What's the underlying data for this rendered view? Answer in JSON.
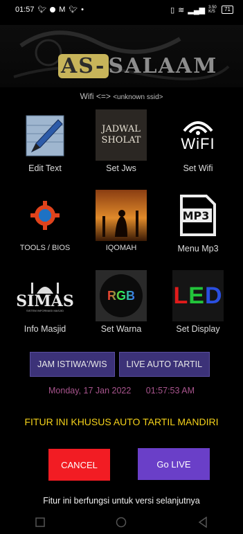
{
  "status_bar": {
    "time": "01:57",
    "net_speed": "3.50 K/S",
    "battery": "71"
  },
  "app": {
    "brand_prefix": "AS-",
    "brand_name": "SALAAM",
    "wifi_prefix": "Wifi <=>",
    "wifi_ssid": "<unknown ssid>"
  },
  "menu": [
    {
      "label": "Edit Text",
      "icon": "pencil-notebook-icon"
    },
    {
      "label": "Set Jws",
      "icon": "jadwal-sholat-icon",
      "icon_text_1": "JADWAL",
      "icon_text_2": "SHOLAT"
    },
    {
      "label": "Set Wifi",
      "icon": "wifi-icon",
      "icon_text": "WiFI"
    },
    {
      "label": "TOOLS / BIOS",
      "icon": "gear-wrench-icon"
    },
    {
      "label": "IQOMAH",
      "icon": "prayer-silhouette-icon"
    },
    {
      "label": "Menu Mp3",
      "icon": "mp3-file-icon",
      "icon_text": "MP3"
    },
    {
      "label": "Info Masjid",
      "icon": "simas-logo-icon",
      "icon_text": "SIMAS",
      "icon_subtext": "SISTEM INFORMASI MASJID"
    },
    {
      "label": "Set Warna",
      "icon": "rgb-icon",
      "icon_text": "RGB"
    },
    {
      "label": "Set Display",
      "icon": "led-display-icon",
      "icon_text": "LED"
    }
  ],
  "buttons": {
    "istiwa": "JAM ISTIWA'/WIS",
    "live_tartil": "LIVE AUTO TARTIL",
    "cancel": "CANCEL",
    "go_live": "Go LIVE"
  },
  "datetime": {
    "date": "Monday, 17 Jan 2022",
    "time": "01:57:53 AM"
  },
  "notice": {
    "title": "FITUR INI KHUSUS AUTO TARTIL MANDIRI",
    "footer": "Fitur ini berfungsi untuk versi selanjutnya"
  },
  "colors": {
    "accent_purple": "#3c3278",
    "cancel_red": "#f21c23",
    "golive_purple": "#6a3fc8",
    "title_yellow": "#f5d21a",
    "date_pink": "#a8548d"
  }
}
